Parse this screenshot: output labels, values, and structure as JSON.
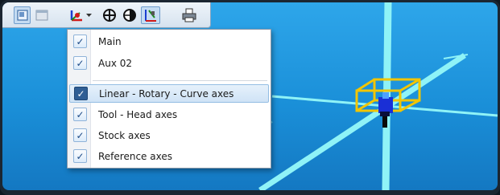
{
  "toolbar": {
    "buttons": [
      {
        "icon": "view-icon",
        "active": true
      },
      {
        "icon": "window-icon",
        "active": false
      },
      {
        "icon": "axes-dropdown-icon",
        "active": false
      },
      {
        "icon": "crosshair-icon",
        "active": false
      },
      {
        "icon": "half-disc-icon",
        "active": false
      },
      {
        "icon": "tool-axes-icon",
        "active": true
      },
      {
        "icon": "printer-icon",
        "active": false
      }
    ]
  },
  "menu": {
    "items": [
      {
        "label": "Main",
        "checked": true
      },
      {
        "label": "Aux 02",
        "checked": true
      },
      {
        "label": "Linear - Rotary - Curve axes",
        "checked": true,
        "highlighted": true
      },
      {
        "label": "Tool - Head axes",
        "checked": true
      },
      {
        "label": "Stock axes",
        "checked": true
      },
      {
        "label": "Reference axes",
        "checked": true
      }
    ]
  },
  "colors": {
    "viewport_bg": "#1a8fd8",
    "axis_line": "#8ff3f7",
    "stock_box": "#f2c500",
    "tool": "#1a2fd6"
  }
}
